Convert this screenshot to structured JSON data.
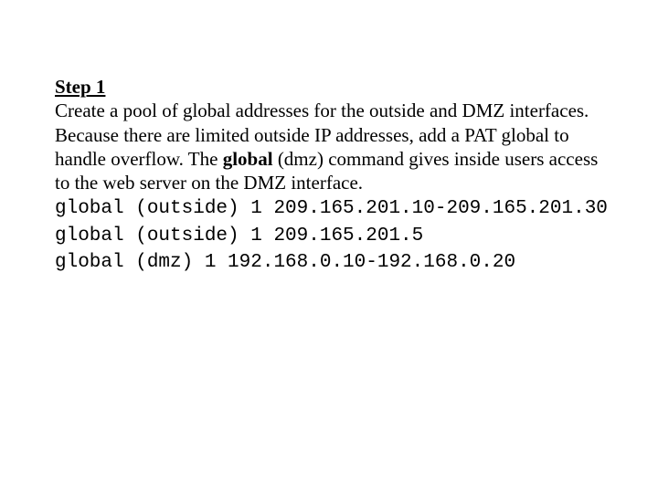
{
  "step_label": "Step 1",
  "desc_part1": "Create a pool of global addresses for the outside and DMZ interfaces. Because there are limited outside IP addresses, add a PAT global to handle overflow. The ",
  "desc_cmd": "global",
  "desc_part2": " (dmz) command gives inside users access to the web server on the DMZ interface.",
  "code": {
    "l1": "global (outside) 1 209.165.201.10-209.165.201.30",
    "l2": "global (outside) 1 209.165.201.5",
    "l3": "global (dmz) 1 192.168.0.10-192.168.0.20"
  }
}
